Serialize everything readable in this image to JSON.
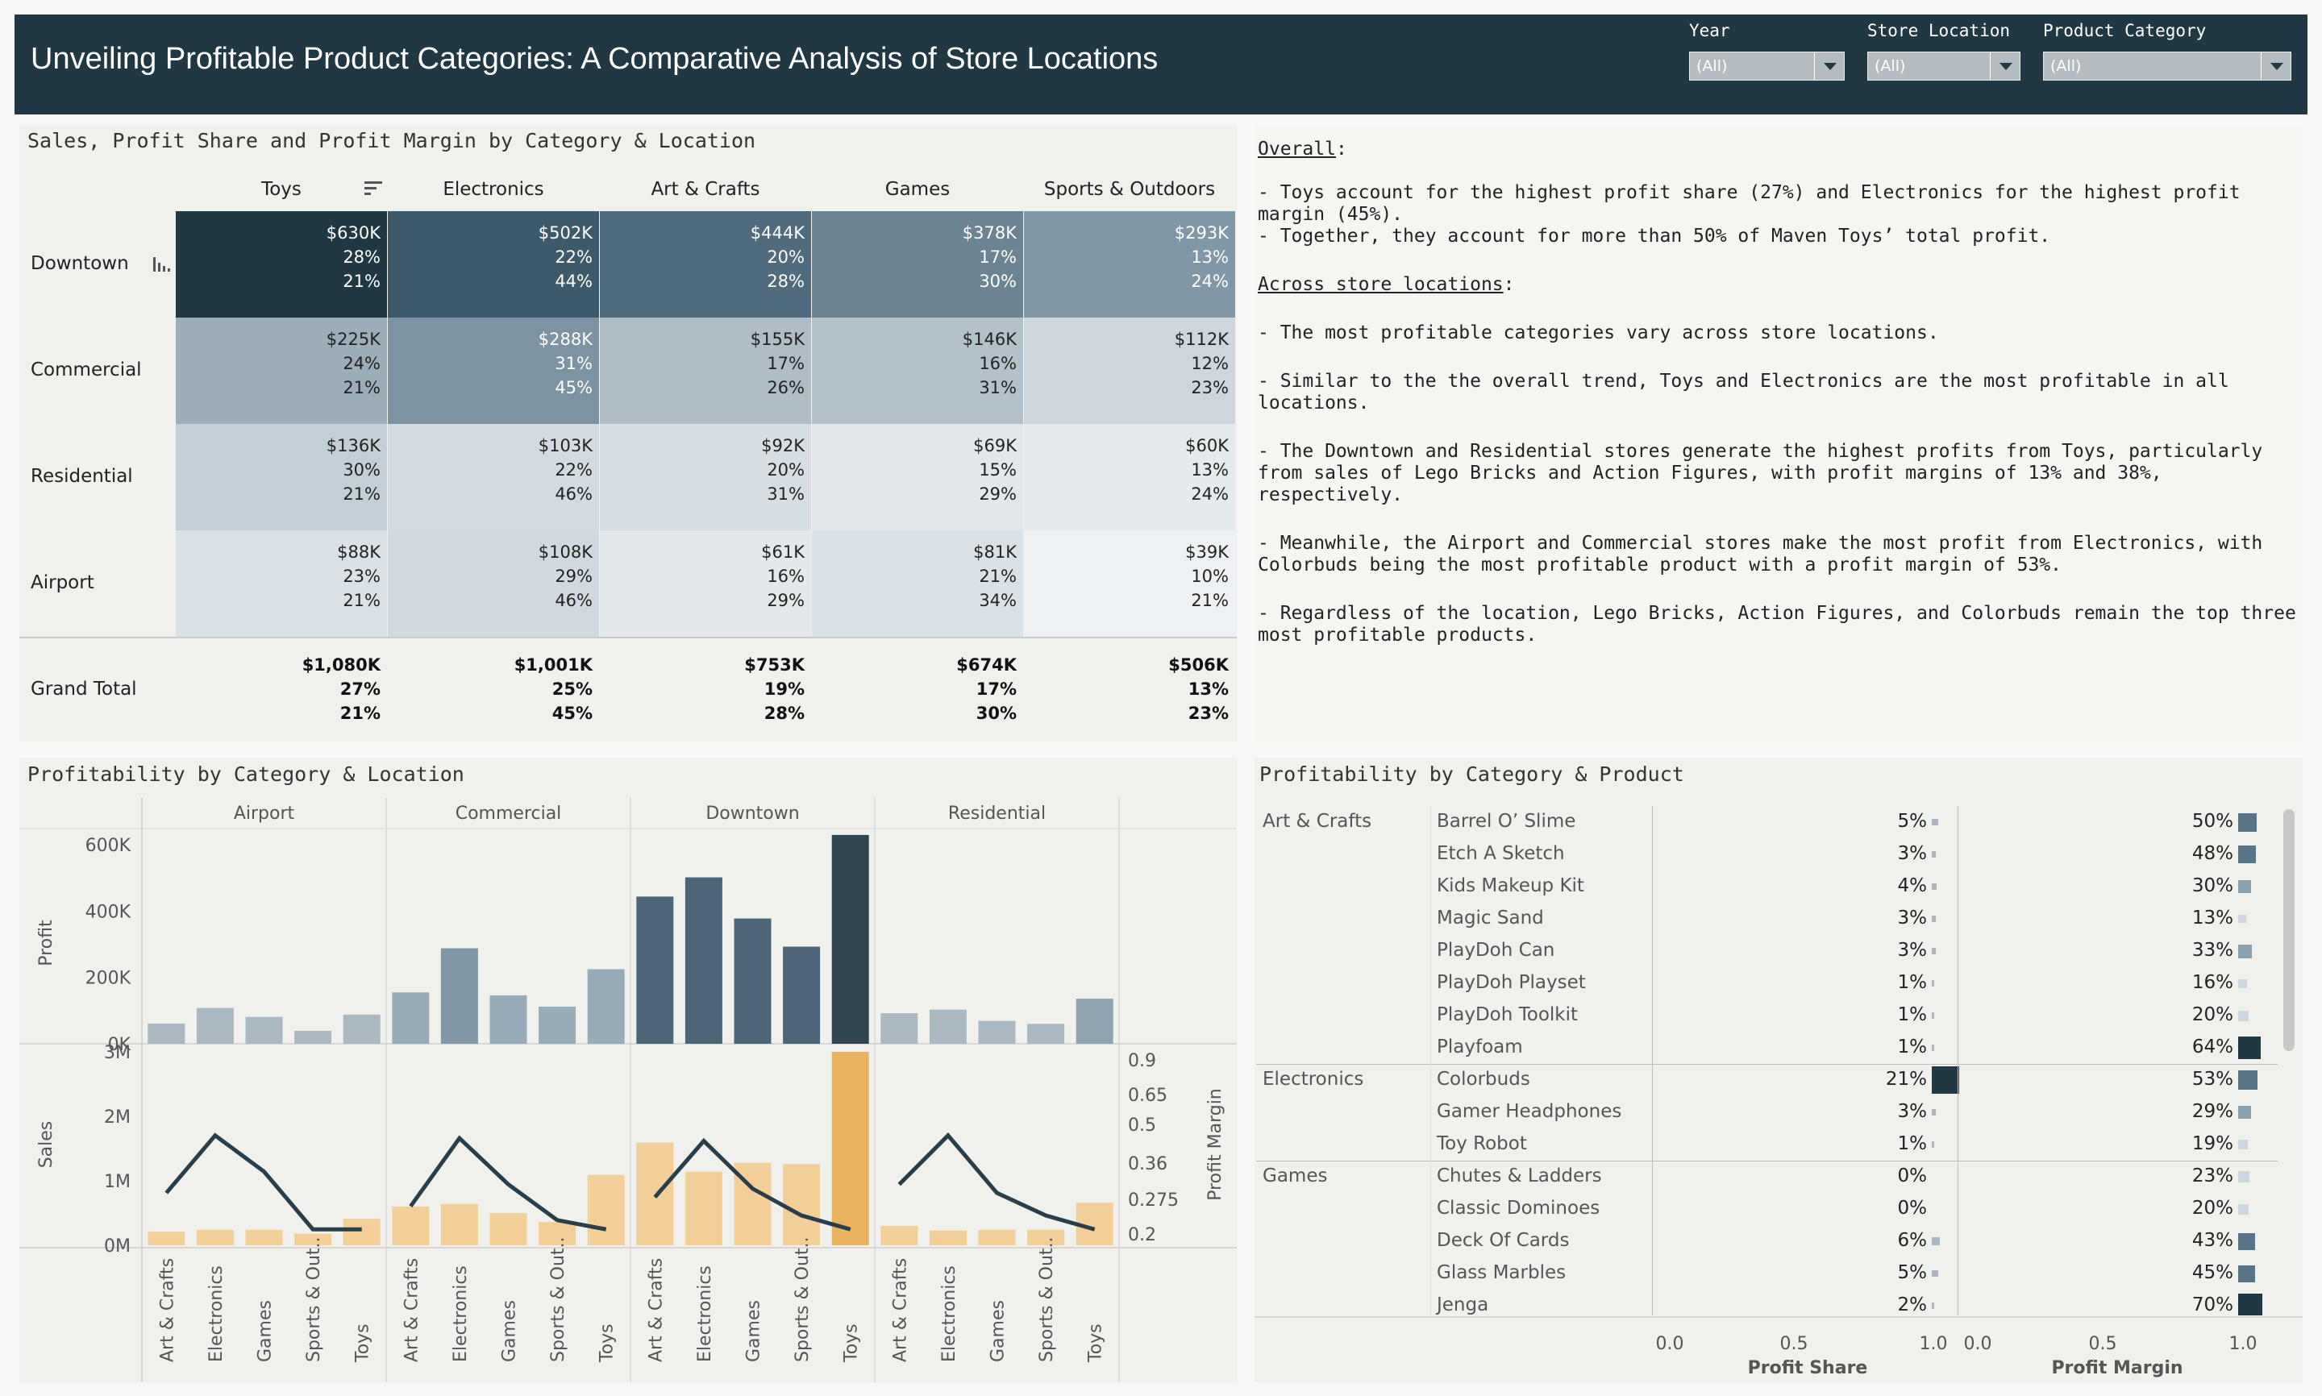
{
  "header": {
    "title": "Unveiling Profitable Product Categories: A Comparative Analysis of Store Locations",
    "filters": [
      {
        "label": "Year",
        "value": "(All)"
      },
      {
        "label": "Store Location",
        "value": "(All)"
      },
      {
        "label": "Product Category",
        "value": "(All)"
      }
    ]
  },
  "table": {
    "title": "Sales, Profit Share and Profit Margin by Category & Location",
    "columns": [
      "Toys",
      "Electronics",
      "Art & Crafts",
      "Games",
      "Sports & Outdoors"
    ],
    "rows": [
      {
        "label": "Downtown",
        "cells": [
          [
            "$630K",
            "28%",
            "21%"
          ],
          [
            "$502K",
            "22%",
            "44%"
          ],
          [
            "$444K",
            "20%",
            "28%"
          ],
          [
            "$378K",
            "17%",
            "30%"
          ],
          [
            "$293K",
            "13%",
            "24%"
          ]
        ]
      },
      {
        "label": "Commercial",
        "cells": [
          [
            "$225K",
            "24%",
            "21%"
          ],
          [
            "$288K",
            "31%",
            "45%"
          ],
          [
            "$155K",
            "17%",
            "26%"
          ],
          [
            "$146K",
            "16%",
            "31%"
          ],
          [
            "$112K",
            "12%",
            "23%"
          ]
        ]
      },
      {
        "label": "Residential",
        "cells": [
          [
            "$136K",
            "30%",
            "21%"
          ],
          [
            "$103K",
            "22%",
            "46%"
          ],
          [
            "$92K",
            "20%",
            "31%"
          ],
          [
            "$69K",
            "15%",
            "29%"
          ],
          [
            "$60K",
            "13%",
            "24%"
          ]
        ]
      },
      {
        "label": "Airport",
        "cells": [
          [
            "$88K",
            "23%",
            "21%"
          ],
          [
            "$108K",
            "29%",
            "46%"
          ],
          [
            "$61K",
            "16%",
            "29%"
          ],
          [
            "$81K",
            "21%",
            "34%"
          ],
          [
            "$39K",
            "10%",
            "21%"
          ]
        ]
      }
    ],
    "total": {
      "label": "Grand Total",
      "cells": [
        [
          "$1,080K",
          "27%",
          "21%"
        ],
        [
          "$1,001K",
          "25%",
          "45%"
        ],
        [
          "$753K",
          "19%",
          "28%"
        ],
        [
          "$674K",
          "17%",
          "30%"
        ],
        [
          "$506K",
          "13%",
          "23%"
        ]
      ]
    },
    "colors": [
      [
        "#1f3844",
        "#3d5a6b",
        "#4f6b7d",
        "#6a8494",
        "#7f97a6"
      ],
      [
        "#9aadb9",
        "#7b93a2",
        "#aebdc6",
        "#b3c1ca",
        "#ccd6dc"
      ],
      [
        "#c3cfd6",
        "#d2dbe1",
        "#d6dee3",
        "#e1e7ea",
        "#e5eaed"
      ],
      [
        "#d9e1e6",
        "#d0d9df",
        "#e3e8eb",
        "#dae1e6",
        "#eef1f3"
      ]
    ]
  },
  "notes": {
    "overall_heading": "Overall",
    "overall": [
      "- Toys account for the highest profit share (27%) and Electronics for the highest profit margin (45%).",
      "- Together, they account for more than 50% of Maven Toys’ total profit."
    ],
    "locations_heading": "Across store locations",
    "locations": [
      "- The most profitable categories vary across store locations.",
      "- Similar to the the overall trend, Toys and Electronics are the most profitable in all locations.",
      "- The Downtown and Residential stores generate the highest profits from Toys, particularly from sales of Lego Bricks and Action Figures, with profit margins of 13% and 38%, respectively.",
      "- Meanwhile, the Airport and Commercial stores make the most profit from Electronics, with Colorbuds being the most profitable product with a profit margin of 53%.",
      "- Regardless of the location, Lego Bricks, Action Figures, and Colorbuds remain the top three most profitable products."
    ]
  },
  "chart_data": [
    {
      "type": "bar",
      "title": "Profitability by Category & Location",
      "facets": [
        "Airport",
        "Commercial",
        "Downtown",
        "Residential"
      ],
      "categories": [
        "Art & Crafts",
        "Electronics",
        "Games",
        "Sports & Out..",
        "Toys"
      ],
      "profit": {
        "ylabel": "Profit",
        "yticks": [
          "600K",
          "400K",
          "200K",
          "0K"
        ],
        "ylim": [
          0,
          620000
        ],
        "values": {
          "Airport": [
            61000,
            108000,
            81000,
            39000,
            88000
          ],
          "Commercial": [
            155000,
            288000,
            146000,
            112000,
            225000
          ],
          "Downtown": [
            444000,
            502000,
            378000,
            293000,
            630000
          ],
          "Residential": [
            92000,
            103000,
            69000,
            60000,
            136000
          ]
        },
        "colors": {
          "Airport": "#a9b8c1",
          "Commercial": "#98abb8",
          "Downtown": "#4d6677",
          "Residential": "#a9b8c1",
          "Downtown-Toys": "#2f4652",
          "Electronics-Commercial": "#7f97a6",
          "Toys-Residential": "#8fa3b0"
        }
      },
      "sales": {
        "ylabel": "Sales",
        "yticks": [
          "3M",
          "2M",
          "1M",
          "0M"
        ],
        "ylim": [
          0,
          3000000
        ],
        "values": {
          "Airport": [
            210000,
            240000,
            240000,
            180000,
            410000
          ],
          "Commercial": [
            600000,
            640000,
            500000,
            360000,
            1090000
          ],
          "Downtown": [
            1590000,
            1140000,
            1280000,
            1260000,
            3000000
          ],
          "Residential": [
            300000,
            230000,
            240000,
            240000,
            660000
          ]
        },
        "color": "#f2cf98",
        "highlight_color": "#e9b25f"
      },
      "margin": {
        "ylabel": "Profit Margin",
        "yticks": [
          "0.9",
          "0.65",
          "0.5",
          "0.36",
          "0.275",
          "0.2"
        ],
        "values": {
          "Airport": [
            0.29,
            0.46,
            0.34,
            0.21,
            0.21
          ],
          "Commercial": [
            0.26,
            0.45,
            0.31,
            0.23,
            0.21
          ],
          "Downtown": [
            0.28,
            0.44,
            0.3,
            0.24,
            0.21
          ],
          "Residential": [
            0.31,
            0.46,
            0.29,
            0.24,
            0.21
          ]
        },
        "color": "#2a3e49"
      }
    },
    {
      "type": "bar",
      "title": "Profitability by Category & Product",
      "xaxes": [
        {
          "label": "Profit Share",
          "ticks": [
            "0.0",
            "0.5",
            "1.0"
          ]
        },
        {
          "label": "Profit Margin",
          "ticks": [
            "0.0",
            "0.5",
            "1.0"
          ]
        }
      ],
      "groups": [
        {
          "category": "Art & Crafts",
          "products": [
            {
              "name": "Barrel O’ Slime",
              "share": "5%",
              "margin": "50%",
              "s": 0.05,
              "m": 0.5
            },
            {
              "name": "Etch A Sketch",
              "share": "3%",
              "margin": "48%",
              "s": 0.03,
              "m": 0.48
            },
            {
              "name": "Kids Makeup Kit",
              "share": "4%",
              "margin": "30%",
              "s": 0.04,
              "m": 0.3
            },
            {
              "name": "Magic Sand",
              "share": "3%",
              "margin": "13%",
              "s": 0.03,
              "m": 0.13
            },
            {
              "name": "PlayDoh Can",
              "share": "3%",
              "margin": "33%",
              "s": 0.03,
              "m": 0.33
            },
            {
              "name": "PlayDoh Playset",
              "share": "1%",
              "margin": "16%",
              "s": 0.01,
              "m": 0.16
            },
            {
              "name": "PlayDoh Toolkit",
              "share": "1%",
              "margin": "20%",
              "s": 0.01,
              "m": 0.2
            },
            {
              "name": "Playfoam",
              "share": "1%",
              "margin": "64%",
              "s": 0.01,
              "m": 0.64
            }
          ]
        },
        {
          "category": "Electronics",
          "products": [
            {
              "name": "Colorbuds",
              "share": "21%",
              "margin": "53%",
              "s": 0.21,
              "m": 0.53
            },
            {
              "name": "Gamer Headphones",
              "share": "3%",
              "margin": "29%",
              "s": 0.03,
              "m": 0.29
            },
            {
              "name": "Toy Robot",
              "share": "1%",
              "margin": "19%",
              "s": 0.01,
              "m": 0.19
            }
          ]
        },
        {
          "category": "Games",
          "products": [
            {
              "name": "Chutes & Ladders",
              "share": "0%",
              "margin": "23%",
              "s": 0.0,
              "m": 0.23
            },
            {
              "name": "Classic Dominoes",
              "share": "0%",
              "margin": "20%",
              "s": 0.0,
              "m": 0.2
            },
            {
              "name": "Deck Of Cards",
              "share": "6%",
              "margin": "43%",
              "s": 0.06,
              "m": 0.43
            },
            {
              "name": "Glass Marbles",
              "share": "5%",
              "margin": "45%",
              "s": 0.05,
              "m": 0.45
            },
            {
              "name": "Jenga",
              "share": "2%",
              "margin": "70%",
              "s": 0.02,
              "m": 0.7
            }
          ]
        }
      ]
    }
  ]
}
